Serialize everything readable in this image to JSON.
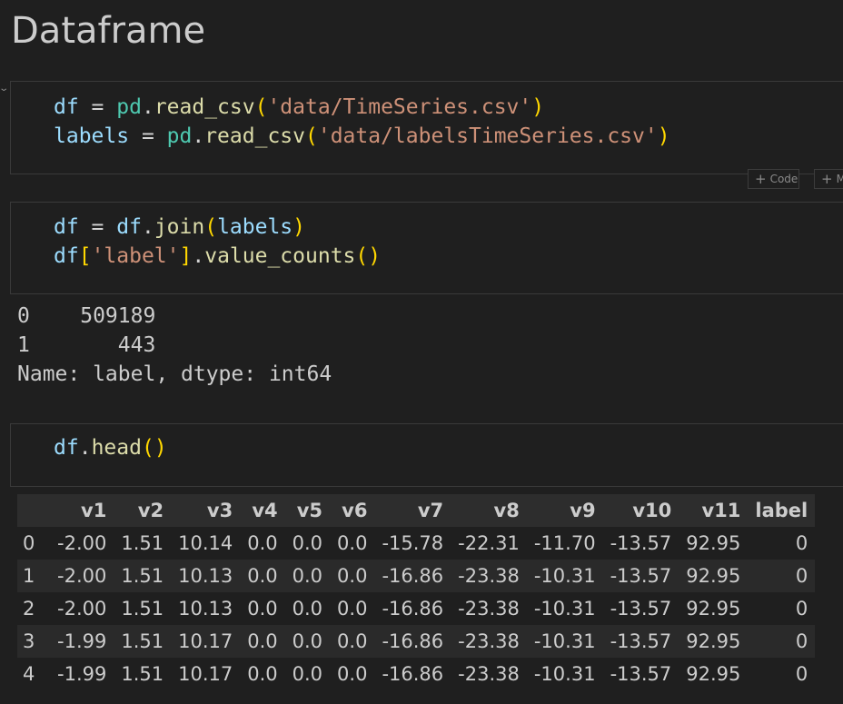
{
  "markdown": {
    "title": "Dataframe"
  },
  "cell1": {
    "line1": {
      "var": "df",
      "eq": " = ",
      "mod": "pd",
      "dot": ".",
      "fn": "read_csv",
      "open": "(",
      "str": "'data/TimeSeries.csv'",
      "close": ")"
    },
    "line2": {
      "var": "labels",
      "eq": " = ",
      "mod": "pd",
      "dot": ".",
      "fn": "read_csv",
      "open": "(",
      "str": "'data/labelsTimeSeries.csv'",
      "close": ")"
    }
  },
  "toolbar": {
    "code_label": "Code",
    "markdown_label": "M"
  },
  "cell2": {
    "line1": {
      "var": "df",
      "eq": " = ",
      "var2": "df",
      "dot": ".",
      "fn": "join",
      "open": "(",
      "arg": "labels",
      "close": ")"
    },
    "line2": {
      "var": "df",
      "bopen": "[",
      "str": "'label'",
      "bclose": "]",
      "dot": ".",
      "fn": "value_counts",
      "open": "(",
      "close": ")"
    }
  },
  "output2": {
    "lines": [
      "0    509189",
      "1       443",
      "Name: label, dtype: int64"
    ]
  },
  "cell3": {
    "line1": {
      "var": "df",
      "dot": ".",
      "fn": "head",
      "open": "(",
      "close": ")"
    }
  },
  "dataframe": {
    "columns": [
      "",
      "v1",
      "v2",
      "v3",
      "v4",
      "v5",
      "v6",
      "v7",
      "v8",
      "v9",
      "v10",
      "v11",
      "label"
    ],
    "rows": [
      [
        "0",
        "-2.00",
        "1.51",
        "10.14",
        "0.0",
        "0.0",
        "0.0",
        "-15.78",
        "-22.31",
        "-11.70",
        "-13.57",
        "92.95",
        "0"
      ],
      [
        "1",
        "-2.00",
        "1.51",
        "10.13",
        "0.0",
        "0.0",
        "0.0",
        "-16.86",
        "-23.38",
        "-10.31",
        "-13.57",
        "92.95",
        "0"
      ],
      [
        "2",
        "-2.00",
        "1.51",
        "10.13",
        "0.0",
        "0.0",
        "0.0",
        "-16.86",
        "-23.38",
        "-10.31",
        "-13.57",
        "92.95",
        "0"
      ],
      [
        "3",
        "-1.99",
        "1.51",
        "10.17",
        "0.0",
        "0.0",
        "0.0",
        "-16.86",
        "-23.38",
        "-10.31",
        "-13.57",
        "92.95",
        "0"
      ],
      [
        "4",
        "-1.99",
        "1.51",
        "10.17",
        "0.0",
        "0.0",
        "0.0",
        "-16.86",
        "-23.38",
        "-10.31",
        "-13.57",
        "92.95",
        "0"
      ]
    ]
  },
  "icons": {
    "chevron": "chevron-down-icon",
    "plus": "plus-icon"
  }
}
